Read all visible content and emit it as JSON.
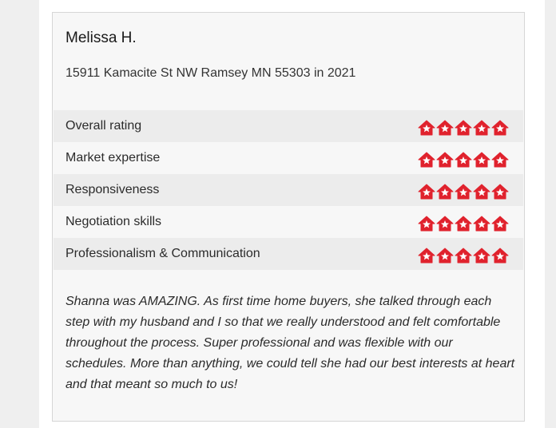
{
  "review": {
    "reviewer_name": "Melissa H.",
    "address": "15911 Kamacite St NW Ramsey MN 55303 in 2021",
    "rating_icon": "house-icon",
    "icon_color": "#e0222d",
    "ratings": [
      {
        "label": "Overall rating",
        "stars": 5,
        "max": 5
      },
      {
        "label": "Market expertise",
        "stars": 5,
        "max": 5
      },
      {
        "label": "Responsiveness",
        "stars": 5,
        "max": 5
      },
      {
        "label": "Negotiation skills",
        "stars": 5,
        "max": 5
      },
      {
        "label": "Professionalism & Communication",
        "stars": 5,
        "max": 5
      }
    ],
    "comment": "Shanna was AMAZING. As first time home buyers, she talked through each step with my husband and I so that we really understood and felt comfortable throughout the process. Super professional and was flexible with our schedules. More than anything, we could tell she had our best interests at heart and that meant so much to us!"
  }
}
